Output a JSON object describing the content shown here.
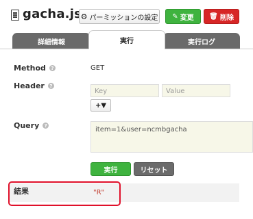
{
  "header": {
    "title": "gacha.js",
    "permission_button": "パーミッションの設定",
    "edit_button": "変更",
    "delete_button": "削除"
  },
  "tabs": [
    {
      "label": "詳細情報",
      "active": false
    },
    {
      "label": "実行",
      "active": true
    },
    {
      "label": "実行ログ",
      "active": false
    }
  ],
  "form": {
    "method": {
      "label": "Method",
      "value": "GET"
    },
    "header": {
      "label": "Header",
      "key_placeholder": "Key",
      "value_placeholder": "Value",
      "add_button": "+▼"
    },
    "query": {
      "label": "Query",
      "value": "item=1&user=ncmbgacha"
    },
    "run_button": "実行",
    "reset_button": "リセット"
  },
  "result": {
    "label": "結果",
    "value": "\"R\""
  },
  "colors": {
    "green": "#3fb33f",
    "red": "#d72626",
    "highlight": "#e0102a",
    "tab_inactive": "#6a6a6a"
  }
}
